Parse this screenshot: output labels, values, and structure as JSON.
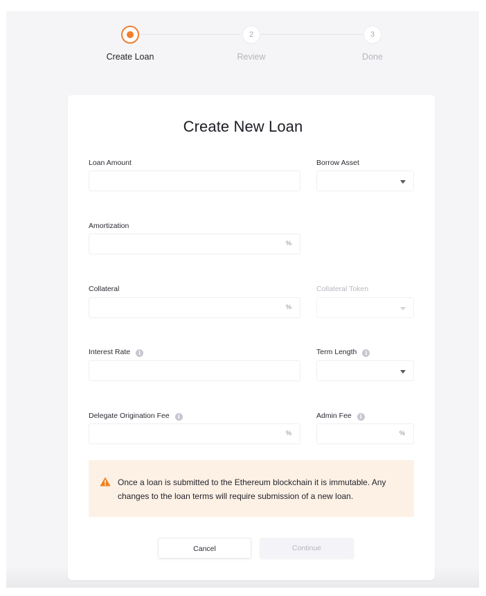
{
  "stepper": {
    "steps": [
      {
        "number": "",
        "label": "Create Loan",
        "state": "active"
      },
      {
        "number": "2",
        "label": "Review",
        "state": "inactive"
      },
      {
        "number": "3",
        "label": "Done",
        "state": "inactive"
      }
    ]
  },
  "form": {
    "title": "Create New Loan",
    "loan_amount": {
      "label": "Loan Amount",
      "value": ""
    },
    "borrow_asset": {
      "label": "Borrow Asset",
      "value": ""
    },
    "amortization": {
      "label": "Amortization",
      "value": "",
      "suffix": "%"
    },
    "collateral": {
      "label": "Collateral",
      "value": "",
      "suffix": "%"
    },
    "collateral_token": {
      "label": "Collateral Token",
      "value": "",
      "disabled": true
    },
    "interest_rate": {
      "label": "Interest Rate",
      "value": ""
    },
    "term_length": {
      "label": "Term Length",
      "value": ""
    },
    "delegate_fee": {
      "label": "Delegate Origination Fee",
      "value": "",
      "suffix": "%"
    },
    "admin_fee": {
      "label": "Admin Fee",
      "value": "",
      "suffix": "%"
    },
    "info_glyph": "i"
  },
  "warning": {
    "icon": "warning-triangle-icon",
    "text": "Once a loan is submitted to the Ethereum blockchain it is immutable. Any changes to the loan terms will require submission of a new loan."
  },
  "actions": {
    "cancel_label": "Cancel",
    "continue_label": "Continue"
  },
  "colors": {
    "accent": "#f27e2e",
    "warning_bg": "#fdf1e6",
    "background": "#f5f5f7"
  }
}
